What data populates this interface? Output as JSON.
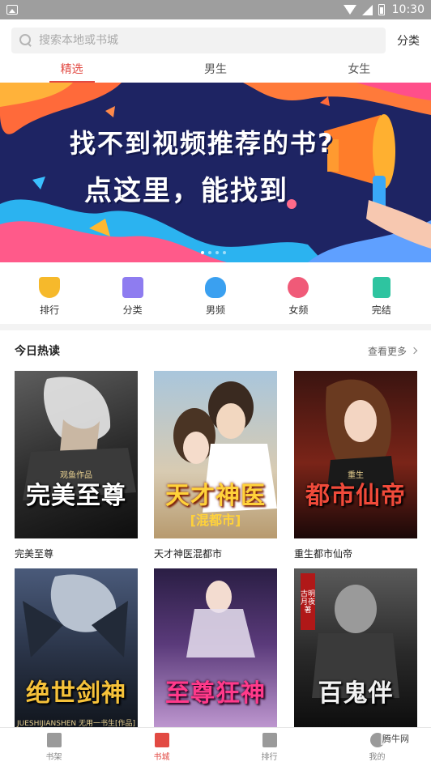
{
  "status_bar": {
    "time": "10:30"
  },
  "search": {
    "placeholder": "搜索本地或书城",
    "category_link": "分类"
  },
  "tabs": [
    {
      "label": "精选",
      "active": true
    },
    {
      "label": "男生",
      "active": false
    },
    {
      "label": "女生",
      "active": false
    }
  ],
  "banner": {
    "line1": "找不到视频推荐的书?",
    "line2": "点这里，能找到",
    "slides": 4,
    "active_slide": 1
  },
  "nav": [
    {
      "label": "排行",
      "icon": "trophy-icon",
      "color": "#f6b92b"
    },
    {
      "label": "分类",
      "icon": "category-icon",
      "color": "#8e7cf0"
    },
    {
      "label": "男频",
      "icon": "male-icon",
      "color": "#3aa0f0"
    },
    {
      "label": "女频",
      "icon": "female-icon",
      "color": "#f05a78"
    },
    {
      "label": "完结",
      "icon": "finished-book-icon",
      "color": "#2ec4a0"
    }
  ],
  "section": {
    "title": "今日热读",
    "more": "查看更多"
  },
  "books": [
    {
      "name": "完美至尊",
      "cover_title": "完美至尊",
      "cover_sub": "观鱼作品",
      "palette": [
        "#2a2a2a",
        "#6b6b6b"
      ]
    },
    {
      "name": "天才神医混都市",
      "cover_title": "天才神医",
      "cover_sub": "[混都市]",
      "palette": [
        "#8fb3cf",
        "#d9c7a8"
      ]
    },
    {
      "name": "重生都市仙帝",
      "cover_title": "都市仙帝",
      "cover_sub": "重生",
      "palette": [
        "#6a1a1a",
        "#2a0d0d"
      ]
    },
    {
      "name": "",
      "cover_title": "绝世剑神",
      "cover_sub": "JUESHIJIANSHEN 无用一书生[作品]",
      "palette": [
        "#3a4a6a",
        "#151a26"
      ]
    },
    {
      "name": "",
      "cover_title": "至尊狂神",
      "cover_sub": "",
      "palette": [
        "#3a2a5a",
        "#b890c8"
      ]
    },
    {
      "name": "",
      "cover_title": "百鬼伴",
      "cover_sub": "古明月夜著",
      "palette": [
        "#555555",
        "#1a1a1a"
      ]
    }
  ],
  "bottom_nav": [
    {
      "label": "书架",
      "active": false
    },
    {
      "label": "书城",
      "active": true
    },
    {
      "label": "排行",
      "active": false
    },
    {
      "label": "我的",
      "active": false
    }
  ],
  "watermark": "腾牛网"
}
